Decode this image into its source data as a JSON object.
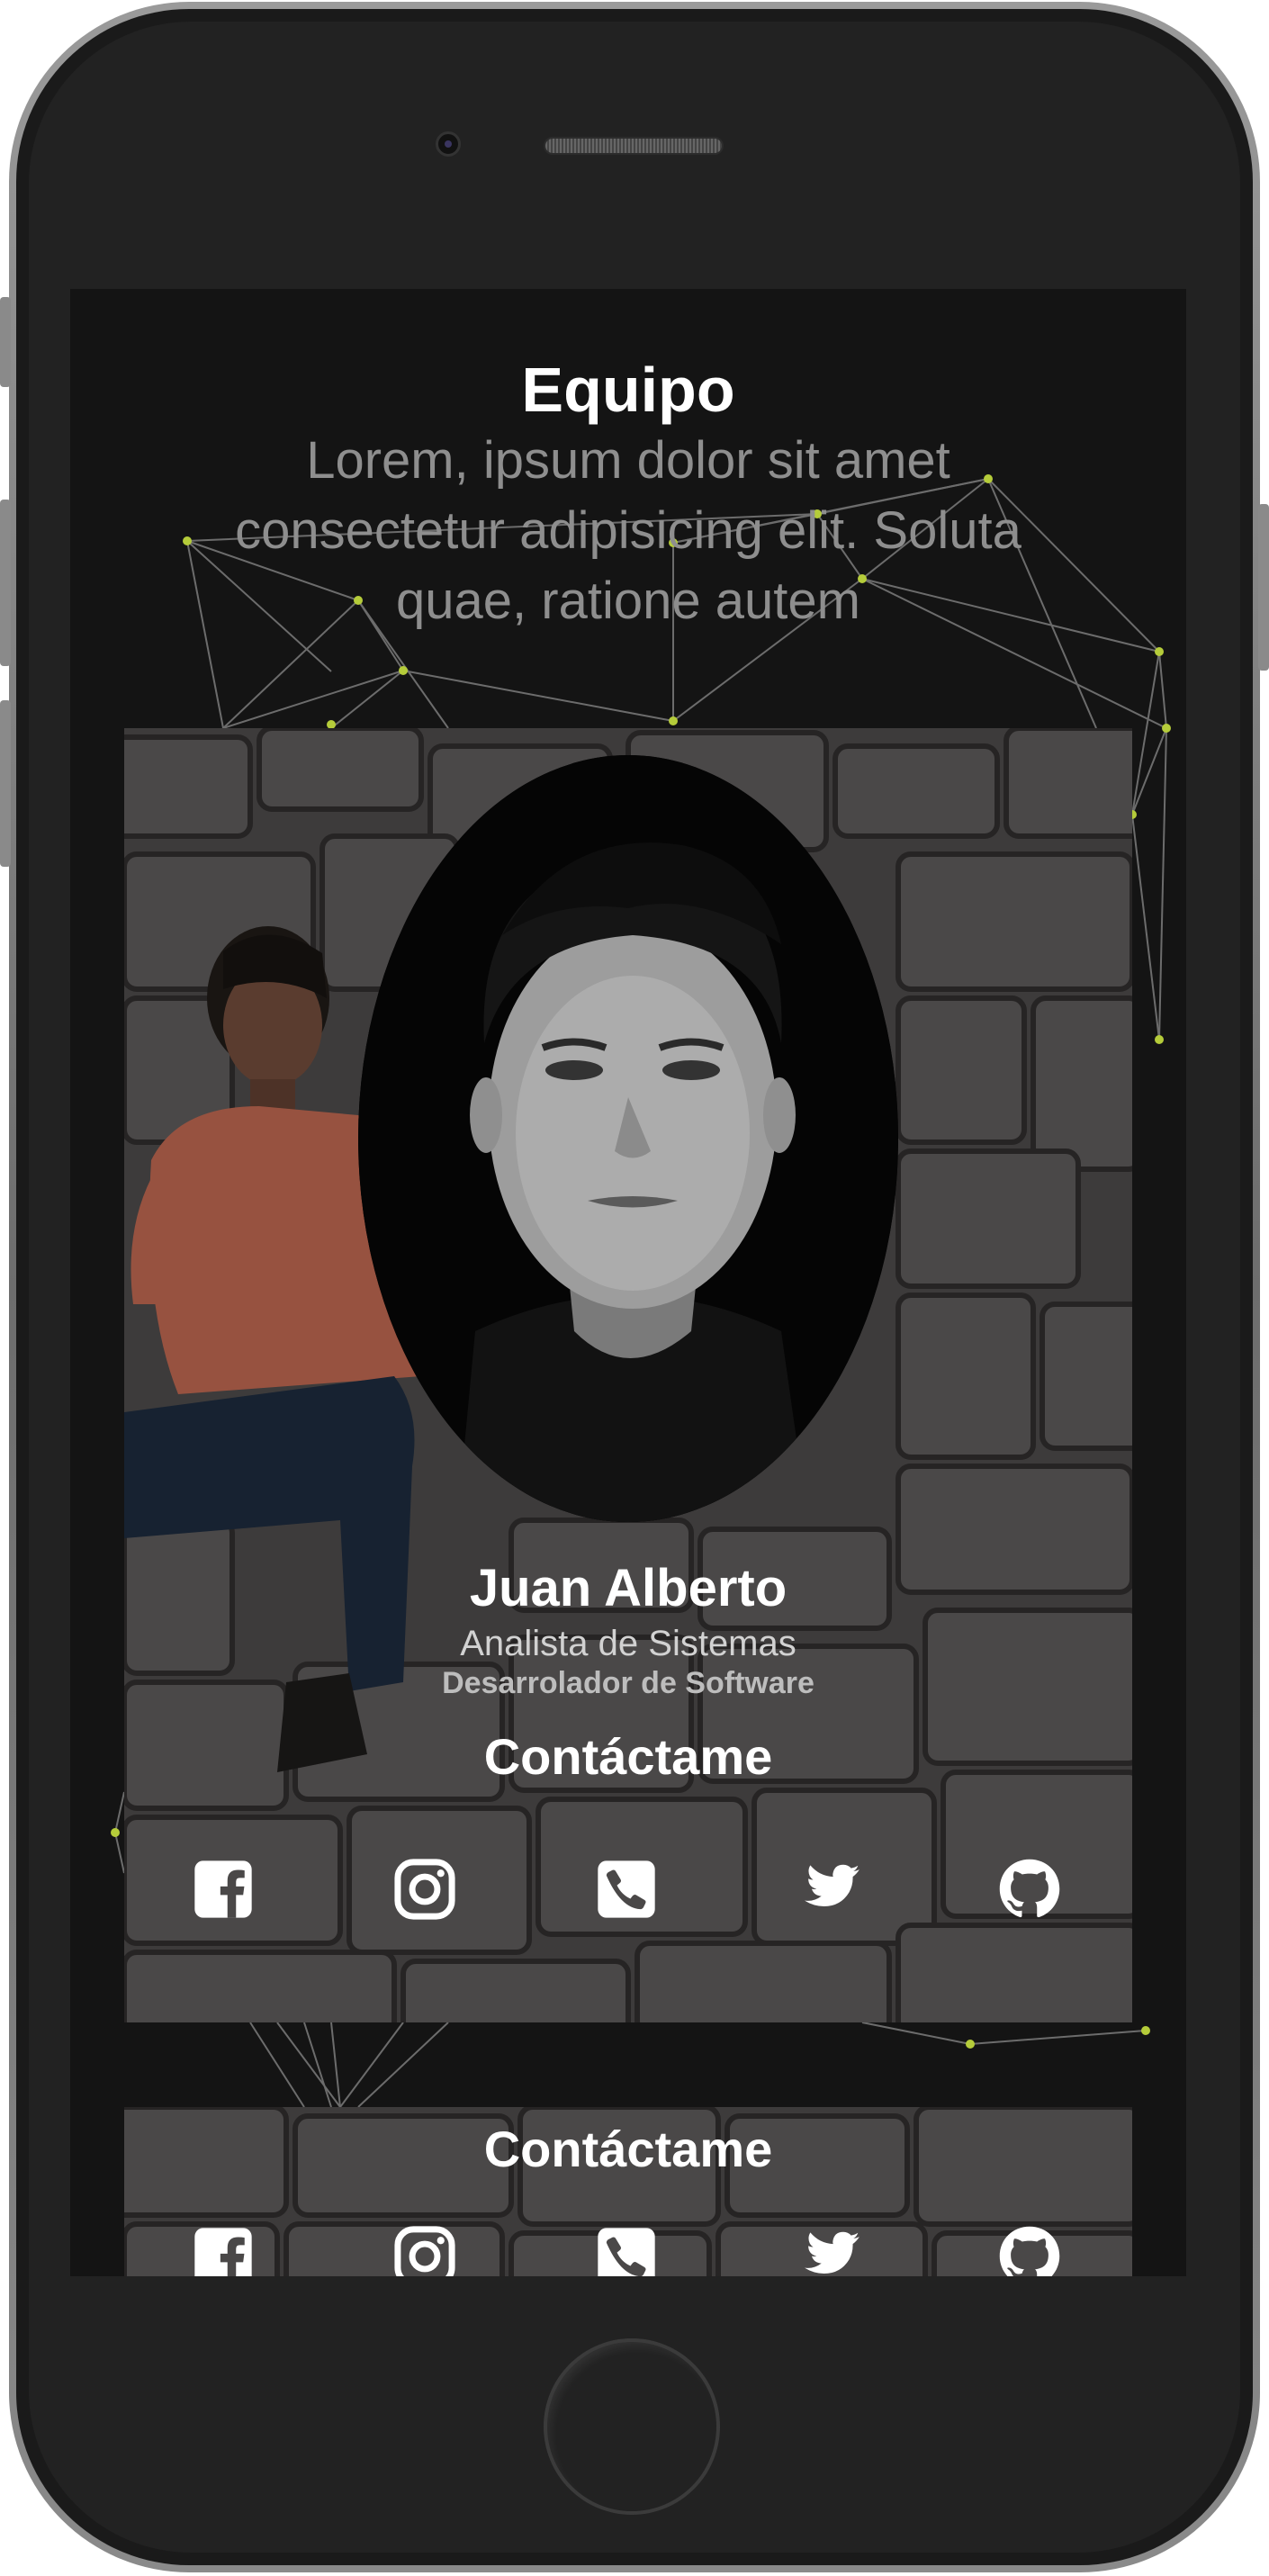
{
  "section": {
    "title": "Equipo",
    "subtitle": "Lorem, ipsum dolor sit amet consectetur adipisicing elit. Soluta quae, ratione autem"
  },
  "member": {
    "name": "Juan Alberto",
    "role": "Analista de Sistemas",
    "specialty": "Desarrolador de Software"
  },
  "contact": {
    "title": "Contáctame",
    "icons": [
      "facebook-icon",
      "instagram-icon",
      "phone-icon",
      "twitter-icon",
      "github-icon"
    ]
  },
  "colors": {
    "screen_background": "#141414",
    "network_line": "#8a8a8a",
    "network_node": "#b5cc3a",
    "title": "#ffffff",
    "subtitle": "#8e8e8e"
  }
}
